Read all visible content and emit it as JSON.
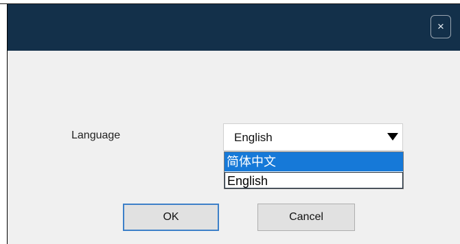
{
  "window": {
    "close_label": "×"
  },
  "form": {
    "language_label": "Language",
    "language_selected": "English"
  },
  "dropdown": {
    "options": [
      {
        "label": "简体中文",
        "highlighted": true
      },
      {
        "label": "English",
        "highlighted": false
      }
    ]
  },
  "buttons": {
    "ok_label": "OK",
    "cancel_label": "Cancel"
  },
  "colors": {
    "titlebar": "#13304a",
    "highlight": "#1679d8",
    "ok_border": "#3c7fc8"
  },
  "icons": {
    "close": "close-icon",
    "dropdown_arrow": "triangle-down-icon"
  }
}
